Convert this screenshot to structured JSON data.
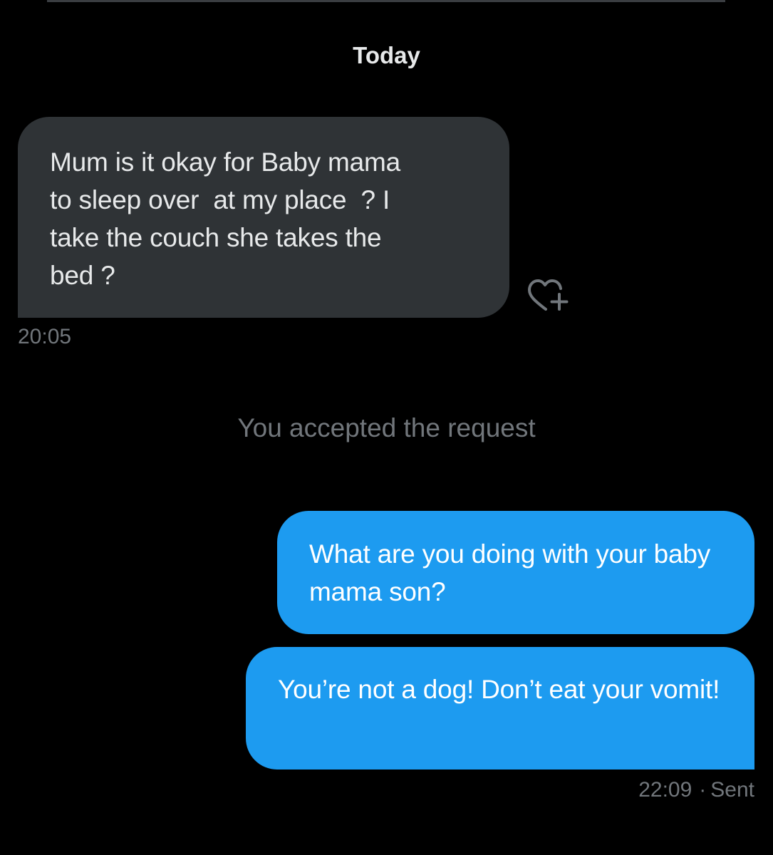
{
  "conversation": {
    "date_separator": "Today",
    "incoming": {
      "text": "Mum is it okay for Baby mama\nto sleep over  at my place  ? I\ntake the couch she takes the\nbed ?",
      "time": "20:05"
    },
    "system_message": "You accepted the request",
    "outgoing": [
      {
        "text": "What are you doing with your baby mama son?"
      },
      {
        "text": "You’re not a dog! Don’t eat your vomit!"
      }
    ],
    "outgoing_time": "22:09",
    "outgoing_separator": "·",
    "outgoing_status": "Sent"
  },
  "icons": {
    "react": "heart-plus-icon"
  },
  "colors": {
    "background": "#000000",
    "incoming_bubble": "#2f3336",
    "outgoing_bubble": "#1d9bf0",
    "muted_text": "#71767b"
  }
}
